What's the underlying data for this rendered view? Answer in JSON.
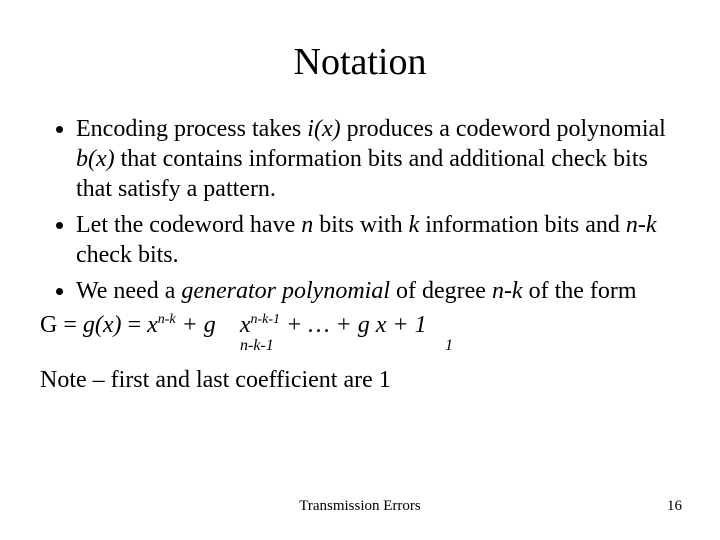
{
  "title": "Notation",
  "bullets": [
    {
      "parts": [
        {
          "t": "Encoding process takes "
        },
        {
          "t": "i(x)",
          "ital": true
        },
        {
          "t": " produces a codeword polynomial "
        },
        {
          "t": "b(x)",
          "ital": true
        },
        {
          "t": " that contains information bits and additional check bits that satisfy a pattern."
        }
      ]
    },
    {
      "parts": [
        {
          "t": "Let the codeword have "
        },
        {
          "t": "n",
          "ital": true
        },
        {
          "t": " bits with "
        },
        {
          "t": "k",
          "ital": true
        },
        {
          "t": " information bits and "
        },
        {
          "t": "n-k",
          "ital": true
        },
        {
          "t": " check bits."
        }
      ]
    },
    {
      "parts": [
        {
          "t": "We need a "
        },
        {
          "t": "generator polynomial",
          "ital": true
        },
        {
          "t": " of degree "
        },
        {
          "t": "n-k",
          "ital": true
        },
        {
          "t": " of the form"
        }
      ]
    }
  ],
  "equation": {
    "lhs": "G = ",
    "gx": "g(x)",
    "eq": "  = ",
    "x1": "x",
    "exp1": "n-k",
    "plus1": " + g",
    "gap1": "    ",
    "x2": "x",
    "exp2": "n-k-1",
    "plus2": " + … +  g  ",
    "x3": "x + 1",
    "sub1": "n-k-1",
    "sub2": "1"
  },
  "note": "Note – first and last coefficient are 1",
  "footer_center": "Transmission Errors",
  "footer_right": "16"
}
